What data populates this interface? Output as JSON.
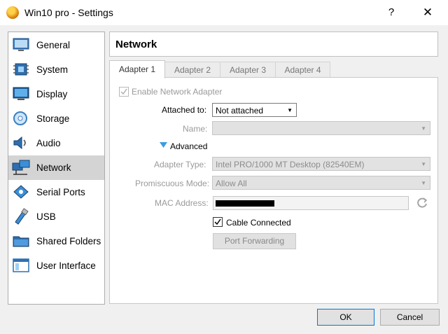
{
  "window": {
    "title": "Win10 pro - Settings",
    "help_glyph": "?",
    "close_glyph": "✕"
  },
  "sidebar": {
    "items": [
      {
        "label": "General",
        "icon": "general-icon"
      },
      {
        "label": "System",
        "icon": "system-chip-icon"
      },
      {
        "label": "Display",
        "icon": "display-monitor-icon"
      },
      {
        "label": "Storage",
        "icon": "storage-disc-icon"
      },
      {
        "label": "Audio",
        "icon": "audio-speaker-icon"
      },
      {
        "label": "Network",
        "icon": "network-icon",
        "selected": true
      },
      {
        "label": "Serial Ports",
        "icon": "serial-port-icon"
      },
      {
        "label": "USB",
        "icon": "usb-icon"
      },
      {
        "label": "Shared Folders",
        "icon": "shared-folder-icon"
      },
      {
        "label": "User Interface",
        "icon": "user-interface-icon"
      }
    ]
  },
  "section": {
    "title": "Network"
  },
  "tabs": [
    "Adapter 1",
    "Adapter 2",
    "Adapter 3",
    "Adapter 4"
  ],
  "adapter": {
    "enable_label": "Enable Network Adapter",
    "enable_checked": true,
    "attached_to_label": "Attached to:",
    "attached_to_value": "Not attached",
    "name_label": "Name:",
    "name_value": "",
    "advanced_label": "Advanced",
    "adapter_type_label": "Adapter Type:",
    "adapter_type_value": "Intel PRO/1000 MT Desktop (82540EM)",
    "promiscuous_label": "Promiscuous Mode:",
    "promiscuous_value": "Allow All",
    "mac_label": "MAC Address:",
    "cable_label": "Cable Connected",
    "cable_checked": true,
    "port_forwarding_label": "Port Forwarding"
  },
  "footer": {
    "ok_label": "OK",
    "cancel_label": "Cancel"
  },
  "colors": {
    "accent": "#0078d7",
    "selected_bg": "#d4d4d4",
    "disabled_text": "#9a9a9a"
  }
}
